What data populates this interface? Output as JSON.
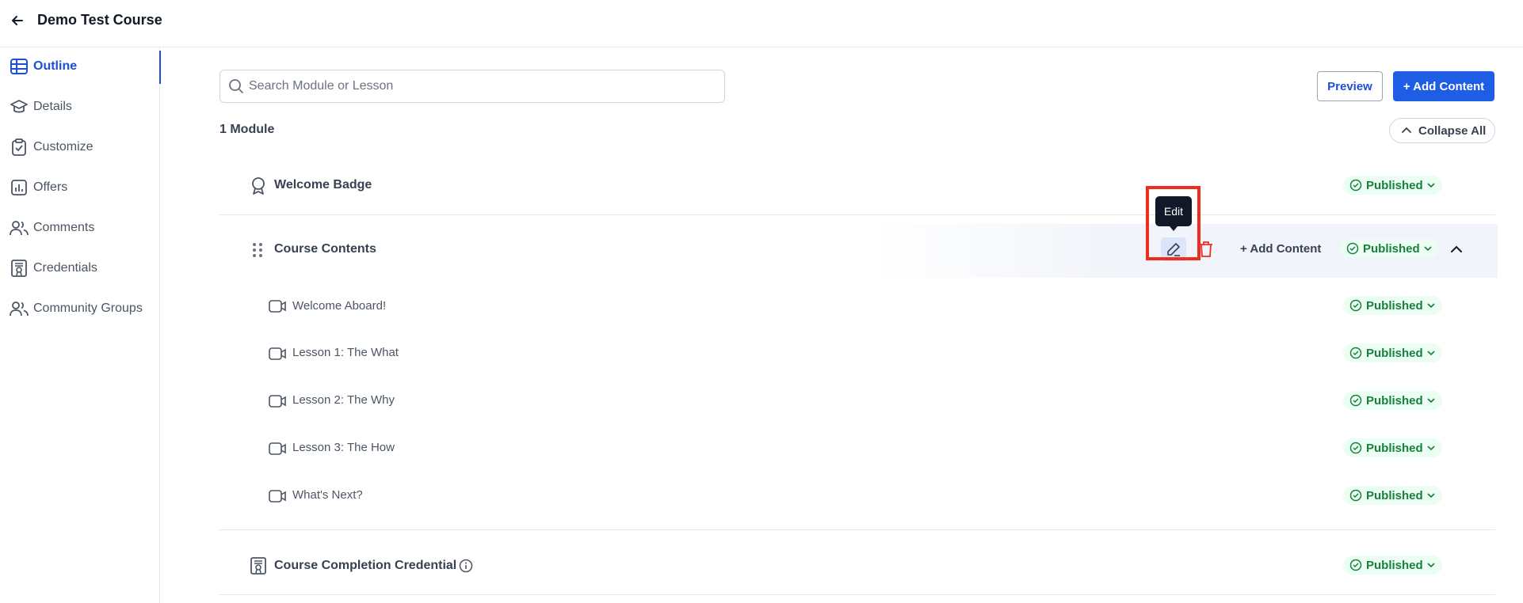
{
  "header": {
    "title": "Demo Test Course"
  },
  "sidebar": {
    "items": [
      {
        "label": "Outline",
        "icon": "table-icon"
      },
      {
        "label": "Details",
        "icon": "graduation-cap-icon"
      },
      {
        "label": "Customize",
        "icon": "clipboard-check-icon"
      },
      {
        "label": "Offers",
        "icon": "bar-chart-icon"
      },
      {
        "label": "Comments",
        "icon": "users-icon"
      },
      {
        "label": "Credentials",
        "icon": "certificate-icon"
      },
      {
        "label": "Community Groups",
        "icon": "users-icon"
      }
    ],
    "active": "Outline"
  },
  "toolbar": {
    "search_placeholder": "Search Module or Lesson",
    "preview_label": "Preview",
    "add_content_label": "+ Add Content",
    "collapse_label": "Collapse All"
  },
  "outline": {
    "module_count": "1 Module",
    "badge": {
      "title": "Welcome Badge",
      "status": "Published"
    },
    "module": {
      "title": "Course Contents",
      "status": "Published",
      "add_content_label": "+ Add Content",
      "tooltip": "Edit",
      "lessons": [
        {
          "title": "Welcome Aboard!",
          "status": "Published"
        },
        {
          "title": "Lesson 1: The What",
          "status": "Published"
        },
        {
          "title": "Lesson 2: The Why",
          "status": "Published"
        },
        {
          "title": "Lesson 3: The How",
          "status": "Published"
        },
        {
          "title": "What's Next?",
          "status": "Published"
        }
      ]
    },
    "credential": {
      "title": "Course Completion Credential",
      "status": "Published"
    }
  },
  "colors": {
    "accent": "#1e5ee4",
    "published_text": "#16803c",
    "published_bg": "#ecfdf3",
    "danger": "#ef2d1e"
  }
}
